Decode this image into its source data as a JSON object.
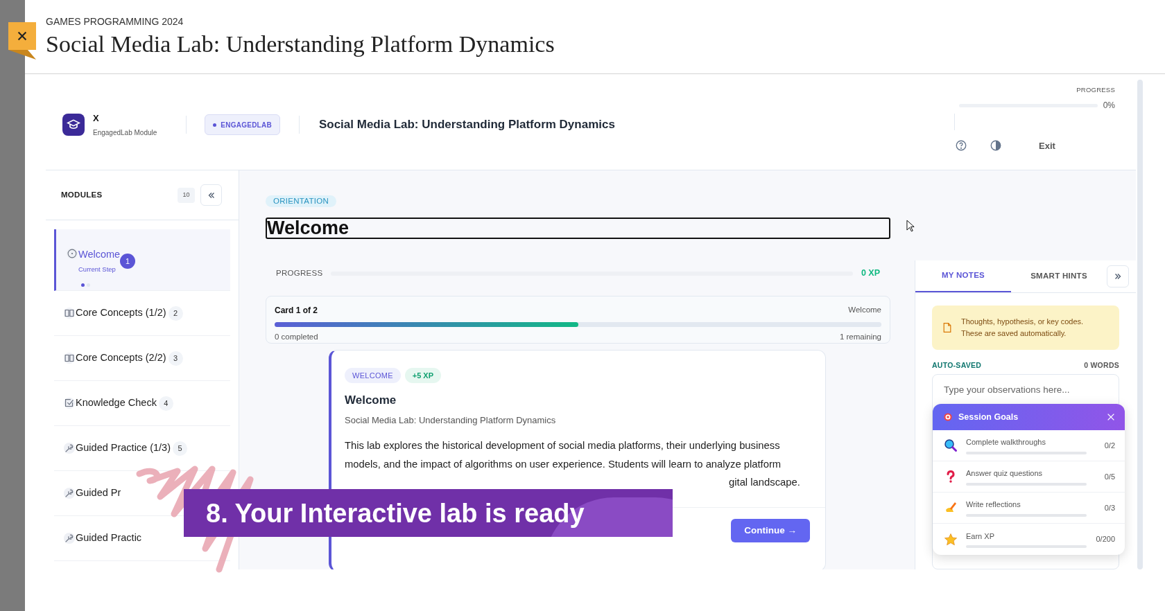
{
  "header": {
    "course": "GAMES PROGRAMMING 2024",
    "title": "Social Media Lab: Understanding Platform Dynamics"
  },
  "topbar": {
    "brand": "X",
    "subtitle": "EngagedLab Module",
    "badge": "ENGAGEDLAB",
    "title": "Social Media Lab: Understanding Platform Dynamics",
    "progress_label": "PROGRESS",
    "progress": {
      "level": 0,
      "reading": "0%"
    },
    "exit": "Exit"
  },
  "sidebar": {
    "title": "MODULES",
    "count": "10",
    "items": [
      {
        "kind": "current",
        "label": "Welcome",
        "sublabel": "Current Step",
        "number": "1",
        "selected": true
      },
      {
        "kind": "book",
        "label": "Core Concepts (1/2)",
        "number": "2",
        "selected": false
      },
      {
        "kind": "book",
        "label": "Core Concepts (2/2)",
        "number": "3",
        "selected": false
      },
      {
        "kind": "check",
        "label": "Knowledge Check",
        "number": "4",
        "selected": false
      },
      {
        "kind": "wrench",
        "label": "Guided Practice (1/3)",
        "number": "5",
        "selected": false
      },
      {
        "kind": "wrench",
        "label": "Guided Pr",
        "selected": false
      },
      {
        "kind": "wrench",
        "label": "Guided Practic",
        "selected": false
      }
    ]
  },
  "main": {
    "tag": "ORIENTATION",
    "heading": "Welcome",
    "xp_progress": {
      "label": "PROGRESS",
      "level": 0,
      "reading": "0 XP"
    },
    "card_progress": {
      "title": "Card 1 of 2",
      "current": "Welcome",
      "level": 0.5,
      "completed": "0 completed",
      "remaining": "1 remaining"
    },
    "card": {
      "tags": [
        {
          "kind": "category",
          "text": "WELCOME"
        },
        {
          "kind": "xp",
          "text": "+5 XP"
        }
      ],
      "title": "Welcome",
      "subtitle": "Social Media Lab: Understanding Platform Dynamics",
      "body": "This lab explores the historical development of social media platforms, their underlying business models, and the impact of algorithms on user experience. Students will learn to analyze platform",
      "body_tail": "gital landscape.",
      "button": "Continue →"
    }
  },
  "notes": {
    "tabs": [
      {
        "label": "MY NOTES",
        "selected": true
      },
      {
        "label": "SMART HINTS",
        "selected": false
      }
    ],
    "note": "Thoughts, hypothesis, or key codes. These are saved automatically.",
    "status": "AUTO-SAVED",
    "word_count": "0 WORDS",
    "placeholder": "Type your observations here...",
    "goals": {
      "title": "Session Goals",
      "items": [
        {
          "kind": "search",
          "label": "Complete walkthroughs",
          "level": 0,
          "reading": "0/2"
        },
        {
          "kind": "question",
          "label": "Answer quiz questions",
          "level": 0,
          "reading": "0/5"
        },
        {
          "kind": "write",
          "label": "Write reflections",
          "level": 0,
          "reading": "0/3"
        },
        {
          "kind": "star",
          "label": "Earn XP",
          "level": 0,
          "reading": "0/200"
        }
      ]
    }
  },
  "overlay": {
    "banner": "8. Your Interactive lab is ready"
  }
}
